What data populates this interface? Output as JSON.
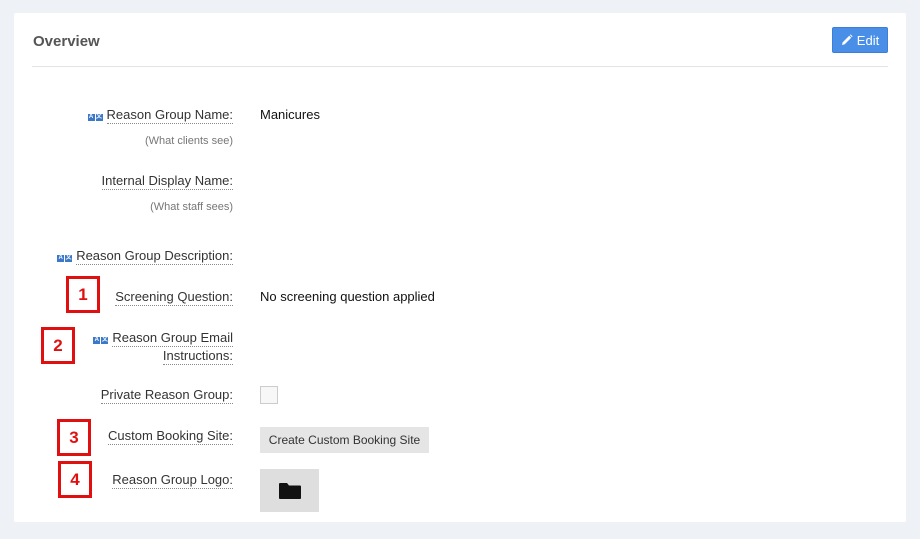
{
  "overview": {
    "title": "Overview",
    "edit_label": "Edit"
  },
  "fields": {
    "reason_group_name": {
      "label": "Reason Group Name:",
      "sub": "(What clients see)",
      "value": "Manicures"
    },
    "internal_display_name": {
      "label": "Internal Display Name:",
      "sub": "(What staff sees)",
      "value": ""
    },
    "reason_group_description": {
      "label": "Reason Group Description:",
      "value": ""
    },
    "screening_question": {
      "label": "Screening Question:",
      "value": "No screening question applied"
    },
    "reason_group_email_instructions": {
      "label_line1": "Reason Group Email",
      "label_line2": "Instructions:",
      "value": ""
    },
    "private_reason_group": {
      "label": "Private Reason Group:",
      "checked": false
    },
    "custom_booking_site": {
      "label": "Custom Booking Site:",
      "button_label": "Create Custom Booking Site"
    },
    "reason_group_logo": {
      "label": "Reason Group Logo:",
      "icon": "folder-icon"
    }
  },
  "annotations": [
    "1",
    "2",
    "3",
    "4"
  ],
  "colors": {
    "accent": "#4a8fe7",
    "marker": "#e01010"
  }
}
